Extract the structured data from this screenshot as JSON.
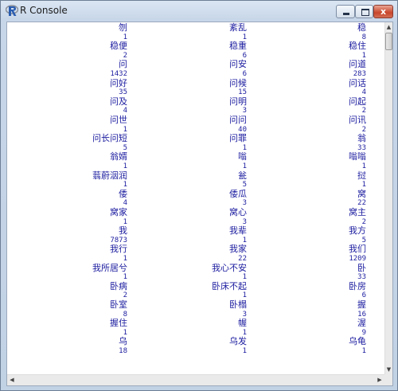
{
  "window": {
    "title": "R Console",
    "icon": "r-logo-icon",
    "controls": {
      "minimize": "minimize",
      "maximize": "maximize",
      "close": "x"
    }
  },
  "console": {
    "rows": [
      [
        "刎",
        "紊乱",
        "稳"
      ],
      [
        "1",
        "1",
        "8"
      ],
      [
        "稳便",
        "稳重",
        "稳住"
      ],
      [
        "2",
        "6",
        "1"
      ],
      [
        "问",
        "问安",
        "问道"
      ],
      [
        "1432",
        "6",
        "283"
      ],
      [
        "问好",
        "问候",
        "问话"
      ],
      [
        "35",
        "15",
        "4"
      ],
      [
        "问及",
        "问明",
        "问起"
      ],
      [
        "4",
        "3",
        "2"
      ],
      [
        "问世",
        "问问",
        "问讯"
      ],
      [
        "1",
        "40",
        "2"
      ],
      [
        "问长问短",
        "问罪",
        "翁"
      ],
      [
        "5",
        "1",
        "33"
      ],
      [
        "翁婿",
        "嗡",
        "嗡嗡"
      ],
      [
        "1",
        "1",
        "1"
      ],
      [
        "蓊蔚洇润",
        "瓮",
        "挝"
      ],
      [
        "1",
        "5",
        "1"
      ],
      [
        "倭",
        "倭瓜",
        "窝"
      ],
      [
        "4",
        "3",
        "22"
      ],
      [
        "窝家",
        "窝心",
        "窝主"
      ],
      [
        "1",
        "3",
        "2"
      ],
      [
        "我",
        "我辈",
        "我方"
      ],
      [
        "7873",
        "1",
        "5"
      ],
      [
        "我行",
        "我家",
        "我们"
      ],
      [
        "1",
        "22",
        "1209"
      ],
      [
        "我所居兮",
        "我心不安",
        "卧"
      ],
      [
        "1",
        "1",
        "33"
      ],
      [
        "卧病",
        "卧床不起",
        "卧房"
      ],
      [
        "2",
        "1",
        "6"
      ],
      [
        "卧室",
        "卧榻",
        "握"
      ],
      [
        "8",
        "3",
        "16"
      ],
      [
        "握住",
        "幄",
        "渥"
      ],
      [
        "1",
        "1",
        "9"
      ],
      [
        "乌",
        "乌发",
        "乌龟"
      ],
      [
        "18",
        "1",
        "1"
      ]
    ]
  },
  "scrollbars": {
    "up_arrow": "▲",
    "down_arrow": "▼",
    "left_arrow": "◀",
    "right_arrow": "▶"
  }
}
